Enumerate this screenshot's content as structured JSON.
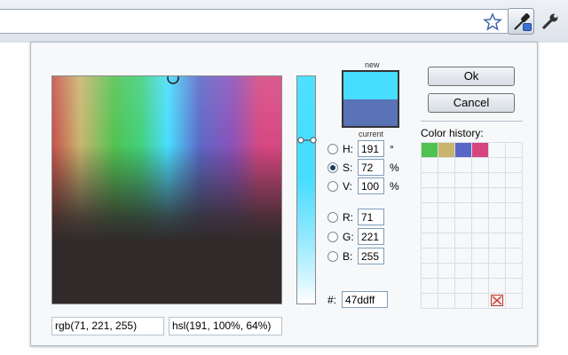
{
  "toolbar": {
    "star_icon": "star-outline-icon",
    "dropper_icon": "eyedropper-icon",
    "wrench_icon": "wrench-icon"
  },
  "picker": {
    "new_label": "new",
    "current_label": "current",
    "new_color": "#47ddff",
    "current_color": "#5a72b6",
    "hsv": {
      "h": {
        "label": "H:",
        "value": "191",
        "unit": "°",
        "checked": false
      },
      "s": {
        "label": "S:",
        "value": "72",
        "unit": "%",
        "checked": true
      },
      "v": {
        "label": "V:",
        "value": "100",
        "unit": "%",
        "checked": false
      }
    },
    "rgb": {
      "r": {
        "label": "R:",
        "value": "71"
      },
      "g": {
        "label": "G:",
        "value": "221"
      },
      "b": {
        "label": "B:",
        "value": "255"
      }
    },
    "hex": {
      "label": "#:",
      "value": "47ddff"
    },
    "rgb_text": "rgb(71, 221, 255)",
    "hsl_text": "hsl(191, 100%, 64%)"
  },
  "buttons": {
    "ok": "Ok",
    "cancel": "Cancel"
  },
  "history": {
    "title": "Color history:",
    "colors": [
      "#4fc24f",
      "#c9b46d",
      "#5a66c6",
      "#d6457f"
    ],
    "clear_icon": "clear-history-icon"
  }
}
